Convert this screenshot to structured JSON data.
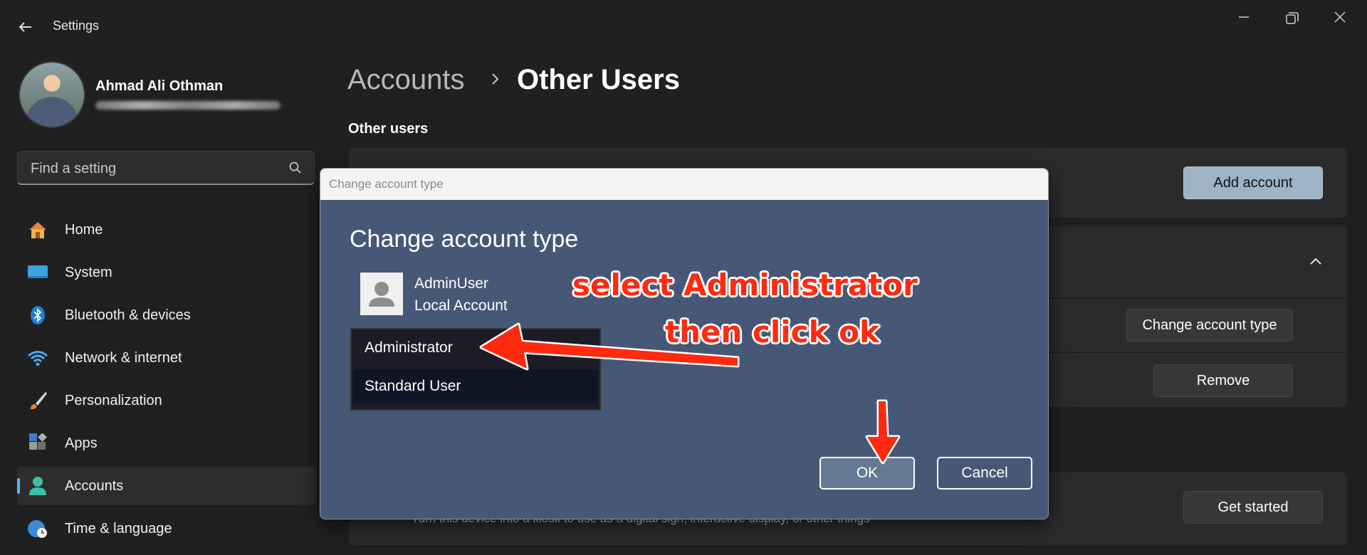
{
  "app": {
    "title": "Settings"
  },
  "user": {
    "name": "Ahmad Ali Othman"
  },
  "search": {
    "placeholder": "Find a setting"
  },
  "sidebar": {
    "items": [
      {
        "label": "Home",
        "icon": "home-icon"
      },
      {
        "label": "System",
        "icon": "system-icon"
      },
      {
        "label": "Bluetooth & devices",
        "icon": "bluetooth-icon"
      },
      {
        "label": "Network & internet",
        "icon": "wifi-icon"
      },
      {
        "label": "Personalization",
        "icon": "brush-icon"
      },
      {
        "label": "Apps",
        "icon": "apps-icon"
      },
      {
        "label": "Accounts",
        "icon": "accounts-icon",
        "selected": true
      },
      {
        "label": "Time & language",
        "icon": "globe-clock-icon"
      }
    ]
  },
  "breadcrumb": {
    "parent": "Accounts",
    "current": "Other Users"
  },
  "main": {
    "section_title": "Other users",
    "add_account_label": "Add account",
    "change_type_label": "Change account type",
    "remove_label": "Remove",
    "kiosk_desc": "Turn this device into a kiosk to use as a digital sign, interactive display, or other things",
    "get_started_label": "Get started"
  },
  "dialog": {
    "window_title": "Change account type",
    "heading": "Change account type",
    "user_name": "AdminUser",
    "user_type": "Local Account",
    "options": [
      "Administrator",
      "Standard User"
    ],
    "selected_option": "Standard User",
    "ok_label": "OK",
    "cancel_label": "Cancel"
  },
  "annotation": {
    "line1": "select Administrator",
    "line2": "then click ok",
    "color": "#ff2a0f"
  },
  "colors": {
    "background": "#202020",
    "card": "#2b2b2b",
    "accent": "#5fb2f2",
    "dialog_bg": "#475876"
  }
}
